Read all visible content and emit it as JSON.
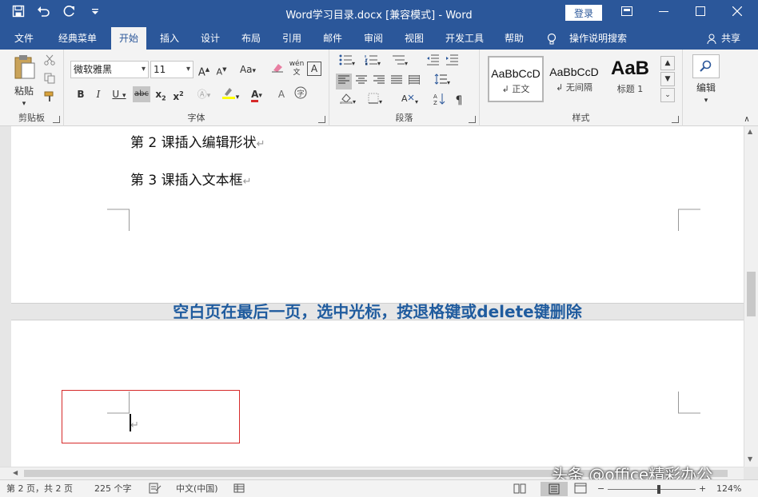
{
  "titlebar": {
    "doc_title": "Word学习目录.docx [兼容模式]  -  Word",
    "login_label": "登录",
    "icons": [
      "save-icon",
      "undo-icon",
      "redo-icon",
      "customize-qat-icon"
    ]
  },
  "tabs": [
    {
      "label": "文件"
    },
    {
      "label": "经典菜单"
    },
    {
      "label": "开始"
    },
    {
      "label": "插入"
    },
    {
      "label": "设计"
    },
    {
      "label": "布局"
    },
    {
      "label": "引用"
    },
    {
      "label": "邮件"
    },
    {
      "label": "审阅"
    },
    {
      "label": "视图"
    },
    {
      "label": "开发工具"
    },
    {
      "label": "帮助"
    },
    {
      "label": "操作说明搜索"
    }
  ],
  "share_label": "共享",
  "ribbon": {
    "clipboard": {
      "label": "剪贴板",
      "paste_label": "粘贴"
    },
    "font": {
      "label": "字体",
      "font_name": "微软雅黑",
      "font_size": "11",
      "case_label": "Aa",
      "phonetic_label": "wén"
    },
    "paragraph": {
      "label": "段落"
    },
    "styles": {
      "label": "样式",
      "items": [
        {
          "sample": "AaBbCcD",
          "name": "↲ 正文"
        },
        {
          "sample": "AaBbCcD",
          "name": "↲ 无间隔"
        },
        {
          "sample": "AaB",
          "name": "标题 1"
        }
      ]
    },
    "editing": {
      "label": "编辑"
    }
  },
  "document": {
    "lines": [
      "第 2 课插入编辑形状",
      "第 3 课插入文本框"
    ],
    "caption": "空白页在最后一页，选中光标，按退格键或delete键删除",
    "paragraph_mark": "↵"
  },
  "statusbar": {
    "page": "第 2 页，共 2 页",
    "words": "225 个字",
    "language": "中文(中国)",
    "zoom": "124%"
  },
  "watermark": "头条 @office精彩办公"
}
